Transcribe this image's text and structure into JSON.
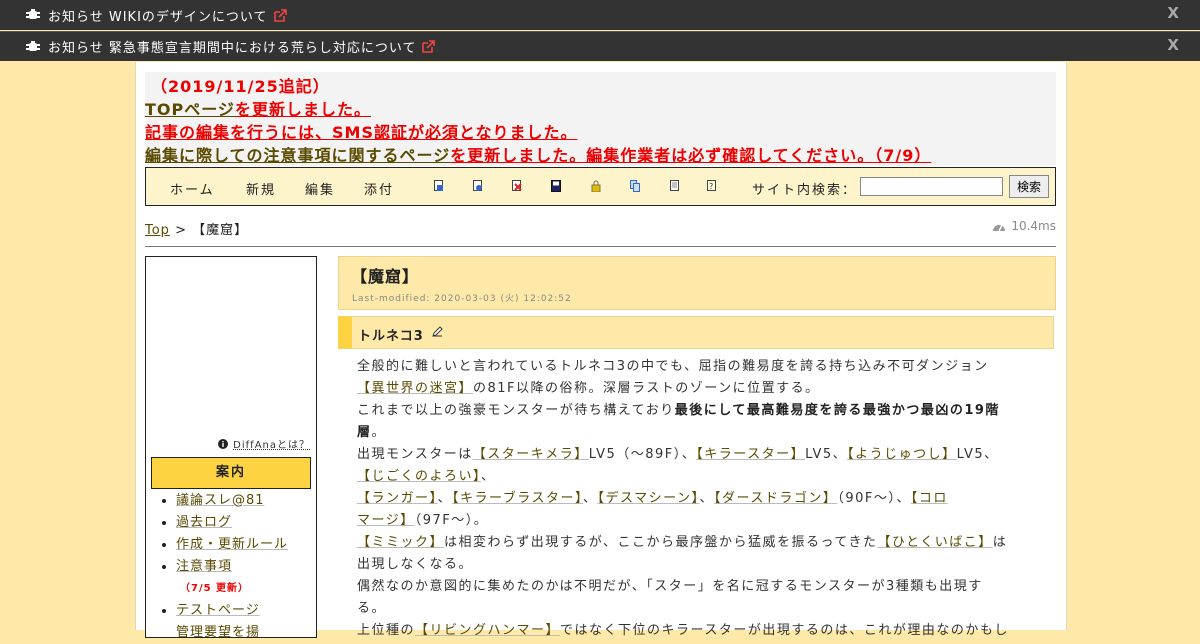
{
  "notices": [
    {
      "label": "お知らせ WIKIのデザインについて",
      "close": "X"
    },
    {
      "label": "お知らせ 緊急事態宣言期間中における荒らし対応について",
      "close": "X"
    }
  ],
  "announcement": {
    "date": "（2019/11/25追記）",
    "l2_link": "TOPページ",
    "l2_text": "を更新しました。",
    "l3_text": "記事の編集を行うには、SMS認証が必須となりました。",
    "l4_link": "編集に際しての注意事項に関するページ",
    "l4_text": "を更新しました。編集作業者は必ず確認してください。（7/9）"
  },
  "toolbar": {
    "home": "ホーム",
    "new": "新規",
    "edit": "編集",
    "attach": "添付",
    "search_label": "サイト内検索：",
    "search_value": "",
    "search_button": "検索"
  },
  "breadcrumb": {
    "top": "Top",
    "sep": ">",
    "current": "【魔窟】"
  },
  "timing": "10.4ms",
  "sidebar": {
    "diffana": "DiffAnaとは？",
    "guide_title": "案内",
    "items": [
      "議論スレ@81",
      "過去ログ",
      "作成・更新ルール",
      "注意事項",
      "テストページ",
      "管理要望を揚"
    ],
    "note": "（7/5 更新）"
  },
  "page": {
    "title": "【魔窟】",
    "last_modified": "Last-modified: 2020-03-03 (火) 12:02:52",
    "section": "トルネコ3"
  },
  "content": {
    "p1a": "全般的に難しいと言われているトルネコ3の中でも、屈指の難易度を誇る持ち込み不可ダンジョン",
    "p1link": "【異世界の迷宮】",
    "p1b": "の81F以降の俗称。深層ラストのゾーンに位置する。",
    "p2a": "これまで以上の強豪モンスターが待ち構えており",
    "p2bold1": "最後にして最高難易度を誇る最強かつ最凶の19階",
    "p2bold2": "層",
    "p2c": "。",
    "p3_lead": "出現モンスターは",
    "m1": "【スターキメラ】",
    "m1t": "LV5（～89F）、",
    "m2": "【キラースター】",
    "m2t": "LV5、",
    "m3": "【ようじゅつし】",
    "m3t": "LV5、",
    "m4": "【じごくのよろい】",
    "m4t": "、",
    "m5": "【ランガー】",
    "m5t": "、",
    "m6": "【キラーブラスター】",
    "m6t": "、",
    "m7": "【デスマシーン】",
    "m7t": "、",
    "m8": "【ダースドラゴン】",
    "m8t": "（90F～）、",
    "m9a": "【コロ",
    "m9b": "マージ】",
    "m9t": "（97F～）。",
    "p4link": "【ミミック】",
    "p4a": "は相変わらず出現するが、ここから最序盤から猛威を振るってきた",
    "p4link2": "【ひとくいばこ】",
    "p4b": "は",
    "p4c": "出現しなくなる。",
    "p5a": "偶然なのか意図的に集めたのかは不明だが、「スター」を名に冠するモンスターが3種類も出現す",
    "p5b": "る。",
    "p6a": "上位種の",
    "p6link": "【リビングハンマー】",
    "p6b": "ではなく下位のキラースターが出現するのは、これが理由なのかもし"
  }
}
